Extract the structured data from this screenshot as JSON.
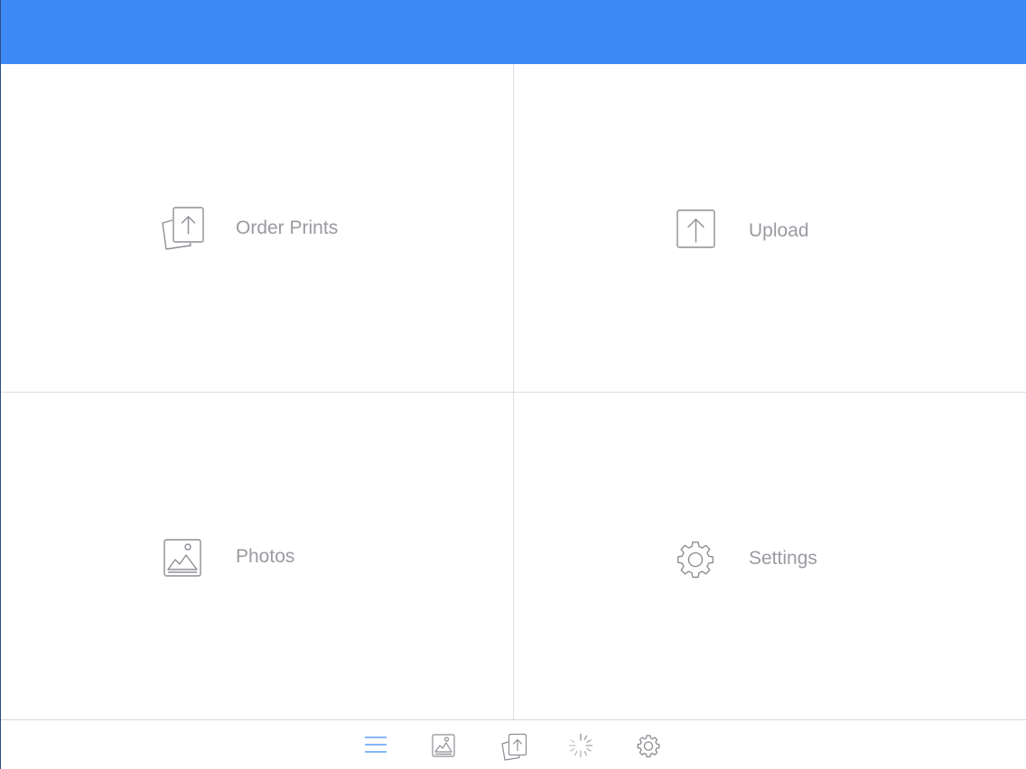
{
  "colors": {
    "header_blue": "#3d8af7",
    "tab_active": "#3d8af7",
    "icon_gray": "#8e8e95",
    "label_gray": "#9a9aa1",
    "divider": "#dcdce2"
  },
  "tiles": [
    {
      "label": "Order Prints",
      "icon": "order-prints-icon"
    },
    {
      "label": "Upload",
      "icon": "upload-icon"
    },
    {
      "label": "Photos",
      "icon": "photos-icon"
    },
    {
      "label": "Settings",
      "icon": "settings-gear-icon"
    }
  ],
  "tab_bar": {
    "items": [
      {
        "icon": "menu-list-icon",
        "active": true
      },
      {
        "icon": "photos-icon",
        "active": false
      },
      {
        "icon": "order-prints-icon",
        "active": false
      },
      {
        "icon": "loading-spinner-icon",
        "active": false
      },
      {
        "icon": "settings-gear-icon",
        "active": false
      }
    ]
  }
}
